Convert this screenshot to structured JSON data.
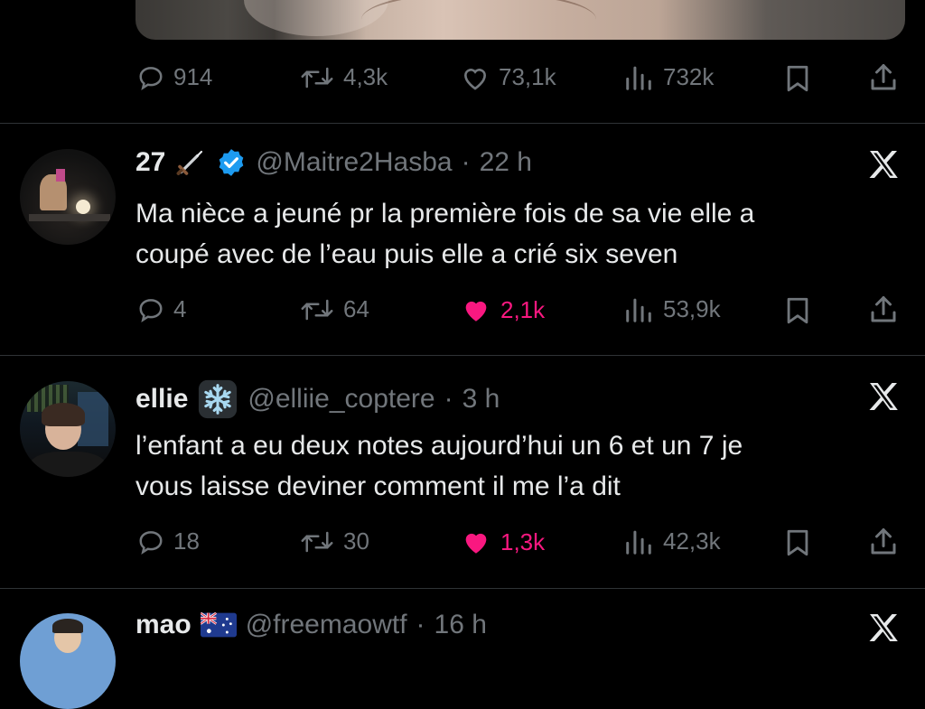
{
  "top_post": {
    "stats": {
      "replies": "914",
      "reposts": "4,3k",
      "likes": "73,1k",
      "views": "732k"
    }
  },
  "tweets": [
    {
      "display_name": "27",
      "handle": "@Maitre2Hasba",
      "time": "22 h",
      "verified": true,
      "badge_icon": "dagger-emoji",
      "lines": [
        "Ma nièce a jeuné pr la première fois de sa vie elle a",
        "coupé avec de l’eau puis elle a crié six seven"
      ],
      "replies": "4",
      "reposts": "64",
      "likes": "2,1k",
      "views": "53,9k",
      "liked": true
    },
    {
      "display_name": "ellie",
      "handle": "@elliie_coptere",
      "time": "3 h",
      "verified": false,
      "badge_icon": "snowflake-emoji",
      "lines": [
        "l’enfant a eu deux notes aujourd’hui un 6 et un 7 je",
        "vous laisse deviner comment il me l’a dit"
      ],
      "replies": "18",
      "reposts": "30",
      "likes": "1,3k",
      "views": "42,3k",
      "liked": true
    },
    {
      "display_name": "mao",
      "handle": "@freemaowtf",
      "time": "16 h",
      "verified": false,
      "badge_icon": "australia-flag-emoji"
    }
  ],
  "separator": "·",
  "colors": {
    "background": "#000000",
    "text": "#e7e9ea",
    "muted": "#71767b",
    "like": "#f91880",
    "verified": "#1d9bf0",
    "divider": "#2f3336"
  }
}
